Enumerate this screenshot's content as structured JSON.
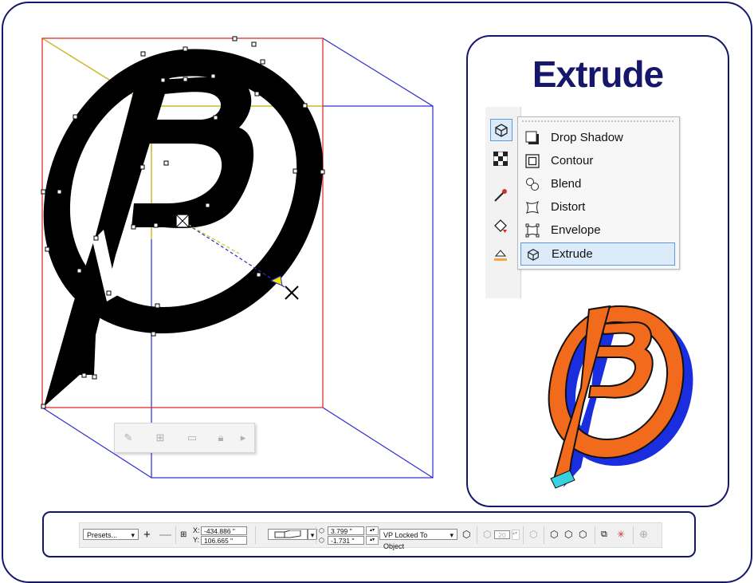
{
  "panel": {
    "title": "Extrude",
    "flyout_items": [
      {
        "label": "Drop Shadow",
        "icon": "drop-shadow-icon"
      },
      {
        "label": "Contour",
        "icon": "contour-icon"
      },
      {
        "label": "Blend",
        "icon": "blend-icon"
      },
      {
        "label": "Distort",
        "icon": "distort-icon"
      },
      {
        "label": "Envelope",
        "icon": "envelope-icon"
      },
      {
        "label": "Extrude",
        "icon": "extrude-icon",
        "active": true
      }
    ]
  },
  "toolbar": {
    "presets_label": "Presets...",
    "x_label": "X:",
    "x_value": "-434.886 \"",
    "y_label": "Y:",
    "y_value": "106.665 \"",
    "vp_x_value": "3.799 \"",
    "vp_y_value": "-1.731 \"",
    "vp_lock_label": "VP Locked To Object",
    "depth_value": "20"
  },
  "colors": {
    "frame": "#16166b",
    "bounding_box": "#e03030",
    "extrude_wire": "#2a2ad0",
    "logo_front": "#f26a1b",
    "logo_side": "#1a2ee0",
    "logo_accent": "#39d1e0",
    "selection_blue": "#dcebfa"
  }
}
